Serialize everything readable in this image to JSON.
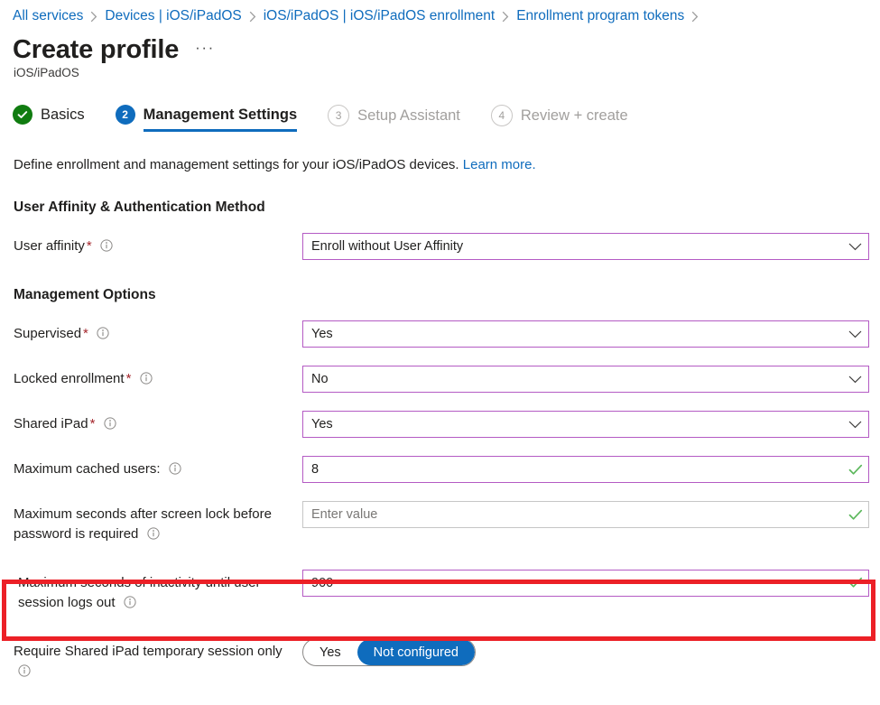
{
  "breadcrumb": {
    "items": [
      {
        "label": "All services"
      },
      {
        "label": "Devices | iOS/iPadOS"
      },
      {
        "label": "iOS/iPadOS | iOS/iPadOS enrollment"
      },
      {
        "label": "Enrollment program tokens"
      }
    ],
    "separator": "›"
  },
  "header": {
    "title": "Create profile",
    "more_label": "···",
    "subtitle": "iOS/iPadOS"
  },
  "steps": [
    {
      "number": "1",
      "label": "Basics",
      "state": "done",
      "badge_glyph": "✓"
    },
    {
      "number": "2",
      "label": "Management Settings",
      "state": "current",
      "badge_glyph": "2"
    },
    {
      "number": "3",
      "label": "Setup Assistant",
      "state": "pending",
      "badge_glyph": "3"
    },
    {
      "number": "4",
      "label": "Review + create",
      "state": "pending",
      "badge_glyph": "4"
    }
  ],
  "description": {
    "text": "Define enrollment and management settings for your iOS/iPadOS devices.",
    "link": "Learn more."
  },
  "sections": {
    "user_affinity_heading": "User Affinity & Authentication Method",
    "management_options_heading": "Management Options"
  },
  "fields": {
    "user_affinity": {
      "label": "User affinity",
      "required_mark": "*",
      "value": "Enroll without User Affinity",
      "control": "dropdown"
    },
    "supervised": {
      "label": "Supervised",
      "required_mark": "*",
      "value": "Yes",
      "control": "dropdown"
    },
    "locked_enrollment": {
      "label": "Locked enrollment",
      "required_mark": "*",
      "value": "No",
      "control": "dropdown"
    },
    "shared_ipad": {
      "label": "Shared iPad",
      "required_mark": "*",
      "value": "Yes",
      "control": "dropdown"
    },
    "max_cached_users": {
      "label": "Maximum cached users:",
      "value": "8",
      "control": "textbox"
    },
    "max_seconds_screen_lock": {
      "label": "Maximum seconds after screen lock before password is required",
      "value": "",
      "placeholder": "Enter value",
      "control": "textbox"
    },
    "max_seconds_inactivity": {
      "label": "Maximum seconds of inactivity until user session logs out",
      "value": "900",
      "control": "textbox",
      "highlighted": true
    },
    "temporary_session_only": {
      "label": "Require Shared iPad temporary session only",
      "control": "toggle",
      "options": [
        "Yes",
        "Not configured"
      ],
      "selected": "Not configured"
    }
  },
  "colors": {
    "link": "#0f6cbd",
    "accent_blue": "#0f6cbd",
    "success_green": "#107c10",
    "field_purple": "#b45bc4",
    "required_red": "#a4262c",
    "highlight_red": "#ec2027",
    "check_green": "#5cb85c"
  }
}
